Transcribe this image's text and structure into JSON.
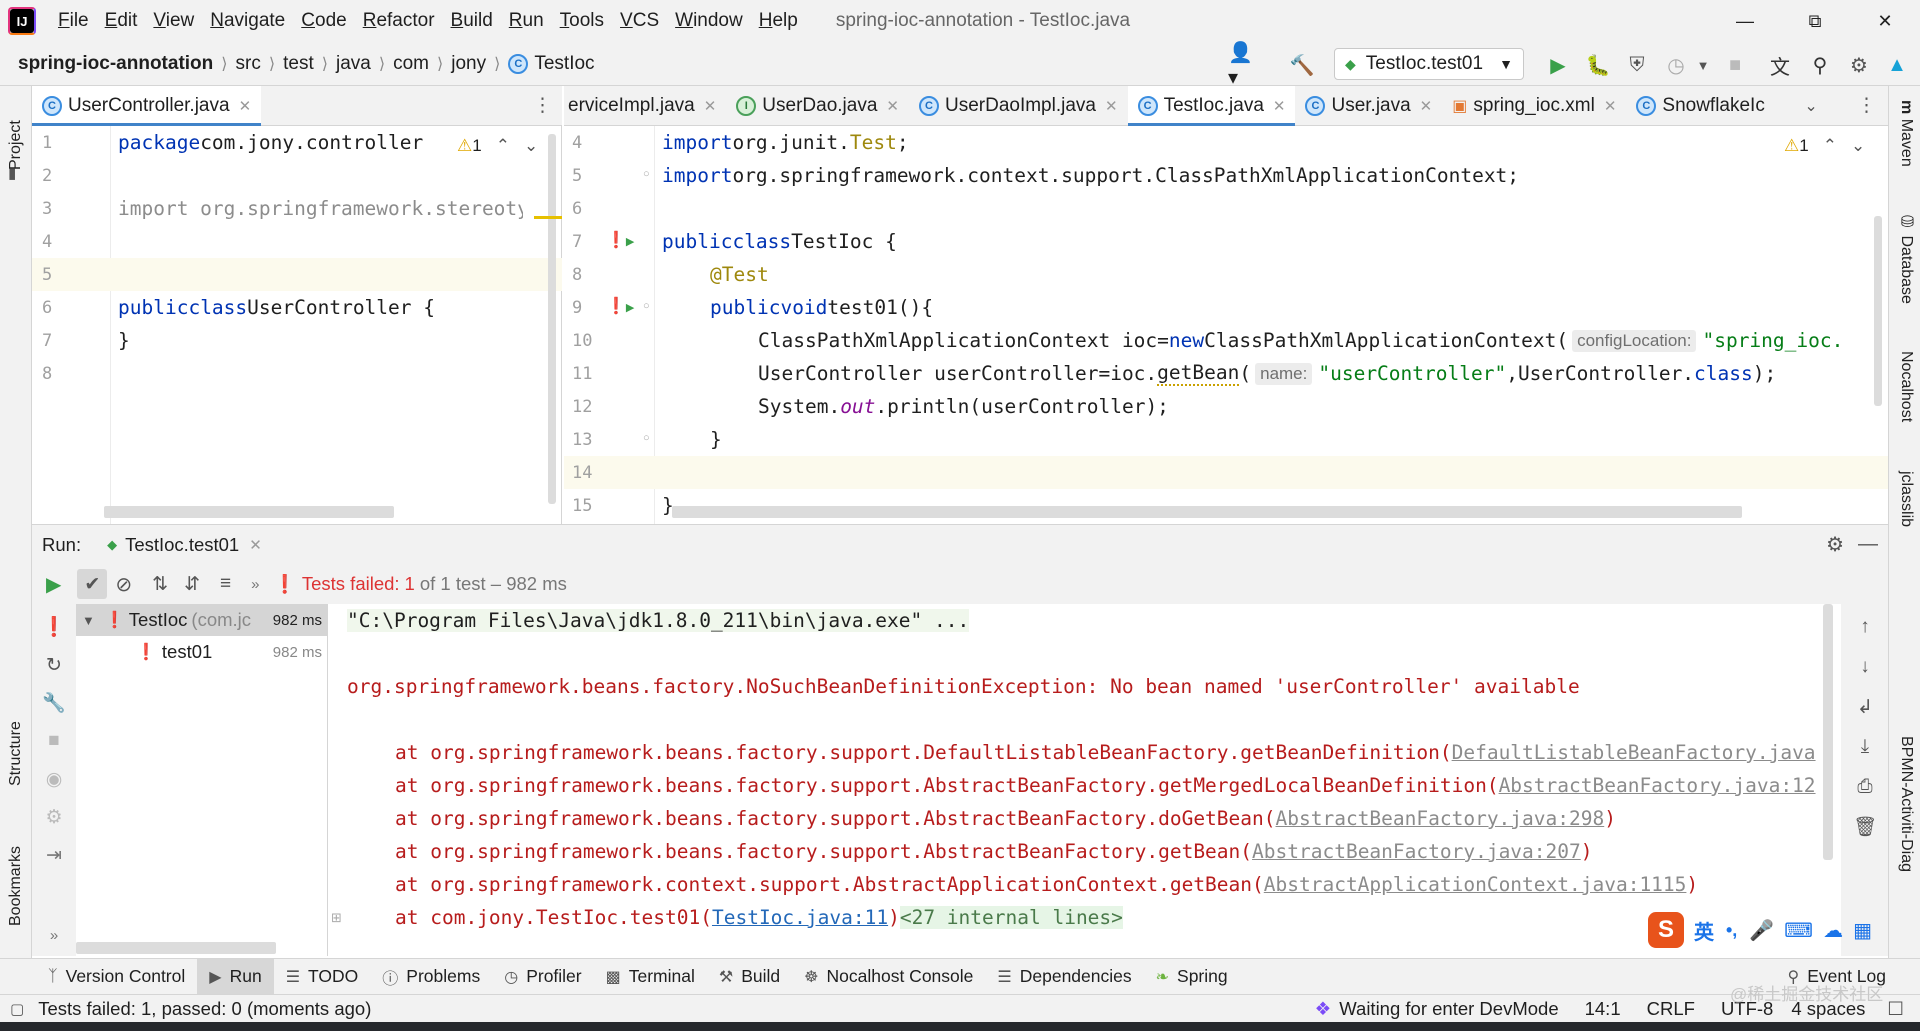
{
  "app": {
    "logo": "IJ",
    "window_title": "spring-ioc-annotation - TestIoc.java",
    "menu": [
      "File",
      "Edit",
      "View",
      "Navigate",
      "Code",
      "Refactor",
      "Build",
      "Run",
      "Tools",
      "VCS",
      "Window",
      "Help"
    ]
  },
  "breadcrumb": {
    "project": "spring-ioc-annotation",
    "parts": [
      "src",
      "test",
      "java",
      "com",
      "jony"
    ],
    "file": "TestIoc"
  },
  "toolbar": {
    "run_config": "TestIoc.test01"
  },
  "left_strip": {
    "project_label": "Project",
    "structure_label": "Structure",
    "bookmarks_label": "Bookmarks"
  },
  "right_strip": {
    "maven_label": "Maven",
    "database_label": "Database",
    "nocalhost_label": "Nocalhost",
    "jclasslib_label": "jclasslib",
    "bpmn_label": "BPMN-Activiti-Diag"
  },
  "left_editor": {
    "tab": "UserController.java",
    "warning_count": "1",
    "lines": [
      {
        "n": "1",
        "text": "package com.jony.controller"
      },
      {
        "n": "2",
        "text": ""
      },
      {
        "n": "3",
        "text": "import org.springframework.stereotype"
      },
      {
        "n": "4",
        "text": ""
      },
      {
        "n": "5",
        "text": ""
      },
      {
        "n": "6",
        "kw1": "public",
        "kw2": "class",
        "rest": "UserController {"
      },
      {
        "n": "7",
        "text": "}"
      },
      {
        "n": "8",
        "text": ""
      }
    ]
  },
  "right_editor": {
    "tabs": [
      "erviceImpl.java",
      "UserDao.java",
      "UserDaoImpl.java",
      "TestIoc.java",
      "User.java",
      "spring_ioc.xml",
      "SnowflakeIc"
    ],
    "warning_count": "1",
    "line_numbers": [
      "4",
      "5",
      "6",
      "7",
      "8",
      "9",
      "10",
      "11",
      "12",
      "13",
      "14",
      "15"
    ],
    "l4": {
      "kw": "import",
      "rest": "org.junit.",
      "cls": "Test",
      "end": ";"
    },
    "l5": {
      "kw": "import",
      "rest": "org.springframework.context.support.ClassPathXmlApplicationContext;"
    },
    "l7": {
      "kw1": "public",
      "kw2": "class",
      "rest": "TestIoc {"
    },
    "l8": {
      "ann": "@Test"
    },
    "l9": {
      "kw1": "public",
      "kw2": "void",
      "rest": "test01(){"
    },
    "l10": {
      "a": "ClassPathXmlApplicationContext ioc=",
      "kw": "new",
      "b": "ClassPathXmlApplicationContext(",
      "hint": "configLocation:",
      "str": "\"spring_ioc."
    },
    "l11": {
      "a": "UserController userController=ioc.",
      "method": "getBean",
      "b": "(",
      "hint": "name:",
      "str": "\"userController\"",
      "c": ",UserController.",
      "kw": "class",
      "d": ");"
    },
    "l12": {
      "a": "System.",
      "field": "out",
      "b": ".println(userController);"
    },
    "l13": {
      "text": "}"
    },
    "l15": {
      "text": "}"
    }
  },
  "run_panel": {
    "label": "Run:",
    "tab": "TestIoc.test01",
    "status_prefix": "Tests failed:",
    "status_count": "1",
    "status_suffix": "of 1 test – 982 ms",
    "tree": [
      {
        "name": "TestIoc",
        "pkg": "(com.jc",
        "time": "982 ms"
      },
      {
        "name": "test01",
        "time": "982 ms"
      }
    ],
    "console": {
      "cmd": "\"C:\\Program Files\\Java\\jdk1.8.0_211\\bin\\java.exe\" ...",
      "exception": "org.springframework.beans.factory.NoSuchBeanDefinitionException: No bean named 'userController' available",
      "stack": [
        {
          "at": "at org.springframework.beans.factory.support.DefaultListableBeanFactory.getBeanDefinition(",
          "link": "DefaultListableBeanFactory.java",
          "end": ""
        },
        {
          "at": "at org.springframework.beans.factory.support.AbstractBeanFactory.getMergedLocalBeanDefinition(",
          "link": "AbstractBeanFactory.java:12",
          "end": ""
        },
        {
          "at": "at org.springframework.beans.factory.support.AbstractBeanFactory.doGetBean(",
          "link": "AbstractBeanFactory.java:298",
          "end": ")"
        },
        {
          "at": "at org.springframework.beans.factory.support.AbstractBeanFactory.getBean(",
          "link": "AbstractBeanFactory.java:207",
          "end": ")"
        },
        {
          "at": "at org.springframework.context.support.AbstractApplicationContext.getBean(",
          "link": "AbstractApplicationContext.java:1115",
          "end": ")"
        }
      ],
      "last": {
        "at": "at com.jony.TestIoc.test01(",
        "link": "TestIoc.java:11",
        "end": ")",
        "fold": "<27 internal lines>"
      }
    }
  },
  "bottom_tools": [
    "Version Control",
    "Run",
    "TODO",
    "Problems",
    "Profiler",
    "Terminal",
    "Build",
    "Nocalhost Console",
    "Dependencies",
    "Spring",
    "Event Log"
  ],
  "status": {
    "left": "Tests failed: 1, passed: 0 (moments ago)",
    "devmode": "Waiting for enter DevMode",
    "position": "14:1",
    "line_sep": "CRLF",
    "encoding": "UTF-8",
    "indent": "4 spaces"
  },
  "ime": {
    "logo": "S",
    "lang": "英",
    "punct": "•,"
  },
  "watermark": "@稀土掘金技术社区",
  "colors": {
    "keyword": "#0033b3",
    "string": "#067d17",
    "annotation": "#9e880d",
    "error": "#b71c1c",
    "accent": "#4083c9",
    "run_green": "#3aa04a"
  }
}
